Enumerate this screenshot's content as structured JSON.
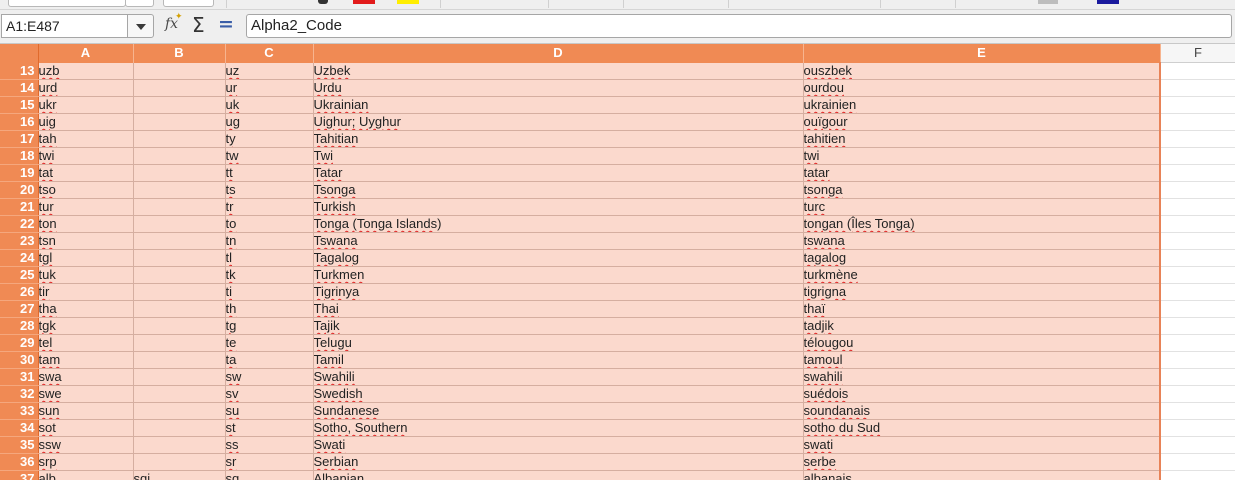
{
  "name_box": "A1:E487",
  "formula": "Alpha2_Code",
  "toolbar": {
    "function_wizard_icon": "fx-wizard-icon",
    "sum_icon": "sum-icon",
    "formula_icon": "equals-icon",
    "sum_glyph": "Σ",
    "equals_glyph": "=",
    "fx_glyph": "fx"
  },
  "colors": {
    "selection_header": "#f08a54",
    "selection_fill": "#fbd9cd",
    "spell_error": "#e02020"
  },
  "columns": [
    "A",
    "B",
    "C",
    "D",
    "E",
    "F"
  ],
  "rows": [
    {
      "n": "13",
      "a": "uzb",
      "b": "",
      "c": "uz",
      "d": "Uzbek",
      "e": "ouszbek"
    },
    {
      "n": "14",
      "a": "urd",
      "b": "",
      "c": "ur",
      "d": "Urdu",
      "e": "ourdou"
    },
    {
      "n": "15",
      "a": "ukr",
      "b": "",
      "c": "uk",
      "d": "Ukrainian",
      "e": "ukrainien"
    },
    {
      "n": "16",
      "a": "uig",
      "b": "",
      "c": "ug",
      "d": "Uighur; Uyghur",
      "e": "ouïgour"
    },
    {
      "n": "17",
      "a": "tah",
      "b": "",
      "c": "ty",
      "d": "Tahitian",
      "e": "tahitien"
    },
    {
      "n": "18",
      "a": "twi",
      "b": "",
      "c": "tw",
      "d": "Twi",
      "e": "twi"
    },
    {
      "n": "19",
      "a": "tat",
      "b": "",
      "c": "tt",
      "d": "Tatar",
      "e": "tatar"
    },
    {
      "n": "20",
      "a": "tso",
      "b": "",
      "c": "ts",
      "d": "Tsonga",
      "e": "tsonga"
    },
    {
      "n": "21",
      "a": "tur",
      "b": "",
      "c": "tr",
      "d": "Turkish",
      "e": "turc"
    },
    {
      "n": "22",
      "a": "ton",
      "b": "",
      "c": "to",
      "d": "Tonga (Tonga Islands)",
      "e": "tongan (Îles Tonga)"
    },
    {
      "n": "23",
      "a": "tsn",
      "b": "",
      "c": "tn",
      "d": "Tswana",
      "e": "tswana"
    },
    {
      "n": "24",
      "a": "tgl",
      "b": "",
      "c": "tl",
      "d": "Tagalog",
      "e": "tagalog"
    },
    {
      "n": "25",
      "a": "tuk",
      "b": "",
      "c": "tk",
      "d": "Turkmen",
      "e": "turkmène"
    },
    {
      "n": "26",
      "a": "tir",
      "b": "",
      "c": "ti",
      "d": "Tigrinya",
      "e": "tigrigna"
    },
    {
      "n": "27",
      "a": "tha",
      "b": "",
      "c": "th",
      "d": "Thai",
      "e": "thaï"
    },
    {
      "n": "28",
      "a": "tgk",
      "b": "",
      "c": "tg",
      "d": "Tajik",
      "e": "tadjik"
    },
    {
      "n": "29",
      "a": "tel",
      "b": "",
      "c": "te",
      "d": "Telugu",
      "e": "télougou"
    },
    {
      "n": "30",
      "a": "tam",
      "b": "",
      "c": "ta",
      "d": "Tamil",
      "e": "tamoul"
    },
    {
      "n": "31",
      "a": "swa",
      "b": "",
      "c": "sw",
      "d": "Swahili",
      "e": "swahili"
    },
    {
      "n": "32",
      "a": "swe",
      "b": "",
      "c": "sv",
      "d": "Swedish",
      "e": "suédois"
    },
    {
      "n": "33",
      "a": "sun",
      "b": "",
      "c": "su",
      "d": "Sundanese",
      "e": "soundanais"
    },
    {
      "n": "34",
      "a": "sot",
      "b": "",
      "c": "st",
      "d": "Sotho, Southern",
      "e": "sotho du Sud"
    },
    {
      "n": "35",
      "a": "ssw",
      "b": "",
      "c": "ss",
      "d": "Swati",
      "e": "swati"
    },
    {
      "n": "36",
      "a": "srp",
      "b": "",
      "c": "sr",
      "d": "Serbian",
      "e": "serbe"
    },
    {
      "n": "37",
      "a": "alb",
      "b": "sqi",
      "c": "sq",
      "d": "Albanian",
      "e": "albanais"
    }
  ]
}
